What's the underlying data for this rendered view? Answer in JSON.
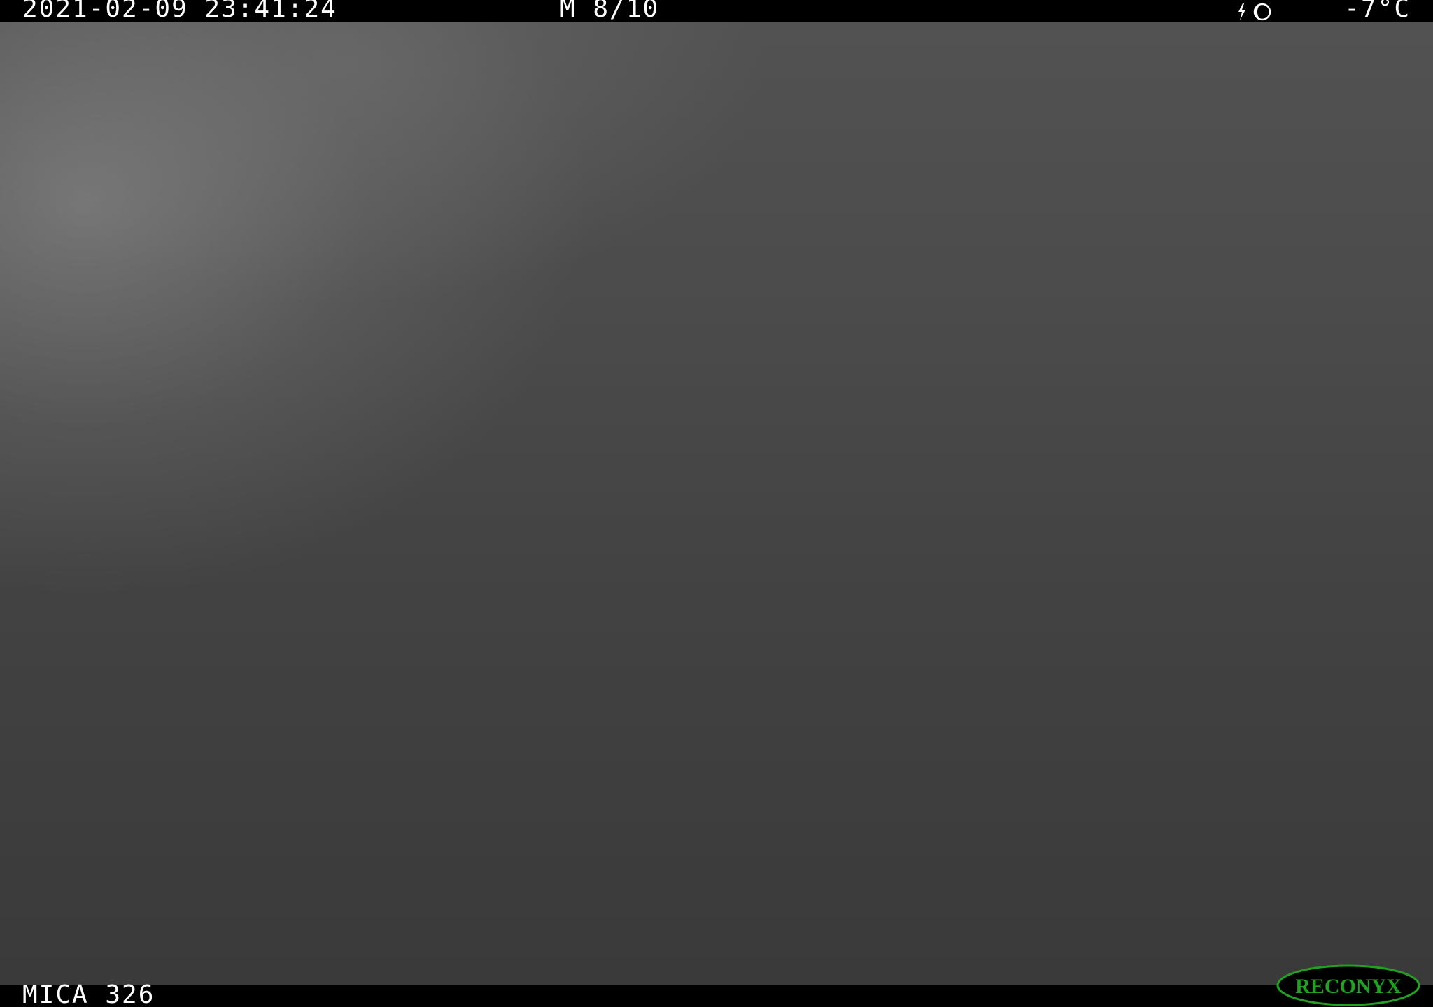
{
  "overlay": {
    "timestamp": "2021-02-09 23:41:24",
    "frame_counter": "M 8/10",
    "temperature": "-7°C",
    "camera_model": "MICA 326",
    "moon_phase_icon": "moon-phase-icon"
  },
  "logo": {
    "text": "RECONYX",
    "color": "#1fa31f"
  },
  "colors": {
    "bar": "#000000",
    "overlay_text": "#ffffff"
  }
}
